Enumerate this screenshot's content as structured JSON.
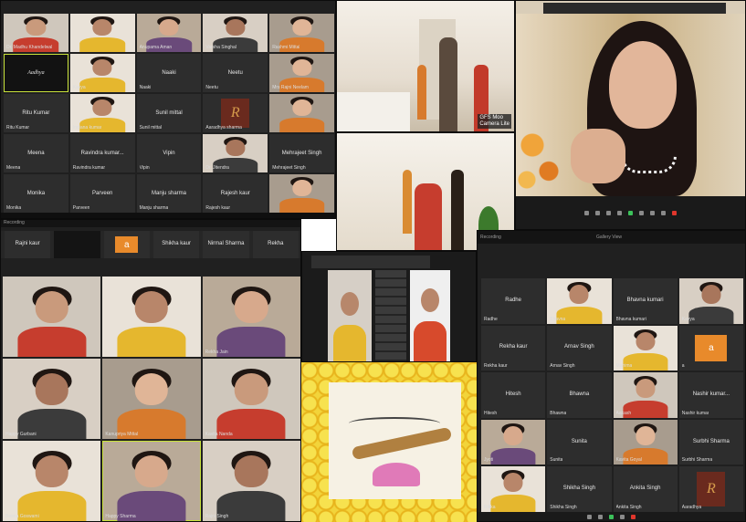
{
  "colors": {
    "zoom_dark": "#202020",
    "tile": "#2d2d2d",
    "active_speaker": "#c8e23a",
    "mic_green": "#3cc15a",
    "leave_red": "#e0362c"
  },
  "panel1": {
    "tiles": [
      {
        "name": "Dr. Madhu Khandelwal",
        "type": "video"
      },
      {
        "name": "",
        "type": "video"
      },
      {
        "name": "Anupama Aman",
        "type": "video"
      },
      {
        "name": "Varsha Singhal",
        "type": "video"
      },
      {
        "name": "Rashmi Mittal",
        "type": "video"
      },
      {
        "name": "Aadhya",
        "type": "logo"
      },
      {
        "name": "Kavya",
        "type": "video"
      },
      {
        "name": "Naaki",
        "label": "Naaki",
        "type": "label"
      },
      {
        "name": "Neetu",
        "label": "Neetu",
        "type": "label"
      },
      {
        "name": "Mrs Rajni Neelam",
        "type": "video"
      },
      {
        "name": "Ritu Kumar",
        "label": "Ritu Kumar",
        "type": "label"
      },
      {
        "name": "Indiana kumar",
        "type": "video"
      },
      {
        "name": "Sunil mittal",
        "label": "Sunil mittal",
        "type": "label"
      },
      {
        "name": "Aaradhya sharma",
        "type": "r-logo"
      },
      {
        "name": "",
        "type": "video"
      },
      {
        "name": "Meena",
        "label": "Meena",
        "type": "label"
      },
      {
        "name": "Ravindra kumar",
        "label": "Ravindra kumar...",
        "type": "label"
      },
      {
        "name": "Vipin",
        "label": "Vipin",
        "type": "label"
      },
      {
        "name": "Dr. Jitendra",
        "type": "video"
      },
      {
        "name": "Mehrajeet Singh",
        "label": "Mehrajeet Singh",
        "type": "label"
      },
      {
        "name": "Monika",
        "label": "Monika",
        "type": "label"
      },
      {
        "name": "Parveen",
        "label": "Parveen",
        "type": "label"
      },
      {
        "name": "Manju sharma",
        "label": "Manju sharma",
        "type": "label"
      },
      {
        "name": "Rajesh kaur",
        "label": "Rajesh kaur",
        "type": "label"
      },
      {
        "name": "",
        "type": "video"
      }
    ]
  },
  "panel2": {
    "badge_line1": "GFS Moo",
    "badge_line2": "Camera Lite"
  },
  "panel3": {},
  "panel4": {
    "header": "Recording",
    "strip": [
      "Rajni kaur",
      "",
      "a",
      "Shikha kaur",
      "Nirmal Sharma",
      "Rekha"
    ],
    "tiles": [
      {
        "name": "",
        "type": "video"
      },
      {
        "name": "",
        "type": "video"
      },
      {
        "name": "Rekha Jain",
        "type": "video"
      },
      {
        "name": "Happy Gurbani",
        "type": "video"
      },
      {
        "name": "Kanupriya Mittal",
        "type": "video"
      },
      {
        "name": "Kavita Nanda",
        "type": "video"
      },
      {
        "name": "Beena Goswami",
        "type": "video"
      },
      {
        "name": "Happy Sharma",
        "type": "video"
      },
      {
        "name": "Rajni Singh",
        "type": "video"
      }
    ]
  },
  "panel6": {
    "header_left": "Recording",
    "header_center": "Gallery View",
    "tiles": [
      {
        "name": "Radhe",
        "label": "Radhe",
        "type": "label"
      },
      {
        "name": "Bhavna",
        "type": "video"
      },
      {
        "name": "Bhavna kumari",
        "label": "Bhavna kumari",
        "type": "label"
      },
      {
        "name": "Kavya",
        "type": "video"
      },
      {
        "name": "Rekha kaur",
        "label": "Rekha kaur",
        "type": "label"
      },
      {
        "name": "Arnav Singh",
        "label": "Arnav Singh",
        "type": "label"
      },
      {
        "name": "Mahima",
        "type": "video"
      },
      {
        "name": "a",
        "type": "orange"
      },
      {
        "name": "Hitesh",
        "label": "Hitesh",
        "type": "label"
      },
      {
        "name": "Bhawna",
        "label": "Bhawna",
        "type": "label"
      },
      {
        "name": "Aakash",
        "type": "video"
      },
      {
        "name": "Nashir kumar",
        "label": "Nashir kumar...",
        "type": "label"
      },
      {
        "name": "Jyoti",
        "type": "video"
      },
      {
        "name": "Sunita",
        "label": "Sunita",
        "type": "label"
      },
      {
        "name": "Kavita Goyal",
        "type": "video"
      },
      {
        "name": "Surbhi Sharma",
        "label": "Surbhi Sharma",
        "type": "label"
      },
      {
        "name": "Ritika",
        "type": "video"
      },
      {
        "name": "Shikha Singh",
        "label": "Shikha Singh",
        "type": "label"
      },
      {
        "name": "Ankita Singh",
        "label": "Ankita Singh",
        "type": "label"
      },
      {
        "name": "Aaradhya",
        "type": "r-logo"
      }
    ]
  }
}
